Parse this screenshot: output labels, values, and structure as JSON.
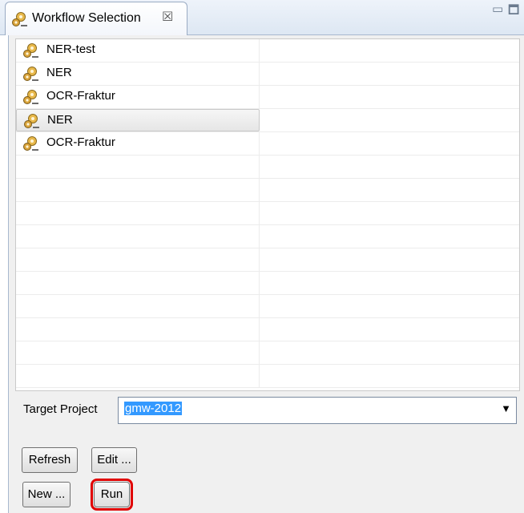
{
  "tab": {
    "title": "Workflow Selection",
    "close_glyph": "☒",
    "icon": "workflow-gears-icon"
  },
  "view_controls": {
    "minimize_glyph": "▭",
    "maximize_glyph": "🗖"
  },
  "workflows": [
    {
      "label": "NER-test",
      "icon": "workflow-gears-icon",
      "selected": false
    },
    {
      "label": "NER",
      "icon": "workflow-gears-icon",
      "selected": false
    },
    {
      "label": "OCR-Fraktur",
      "icon": "workflow-gears-icon",
      "selected": false
    },
    {
      "label": "NER",
      "icon": "workflow-gears-icon",
      "selected": true
    },
    {
      "label": "OCR-Fraktur",
      "icon": "workflow-gears-icon",
      "selected": false
    }
  ],
  "target_project": {
    "label": "Target Project",
    "value": "gmw-2012",
    "arrow_glyph": "▼"
  },
  "buttons": {
    "refresh": "Refresh",
    "edit": "Edit ...",
    "new": "New ...",
    "run": "Run"
  },
  "colors": {
    "selection_highlight": "#3399ff",
    "run_callout": "#e00000"
  }
}
